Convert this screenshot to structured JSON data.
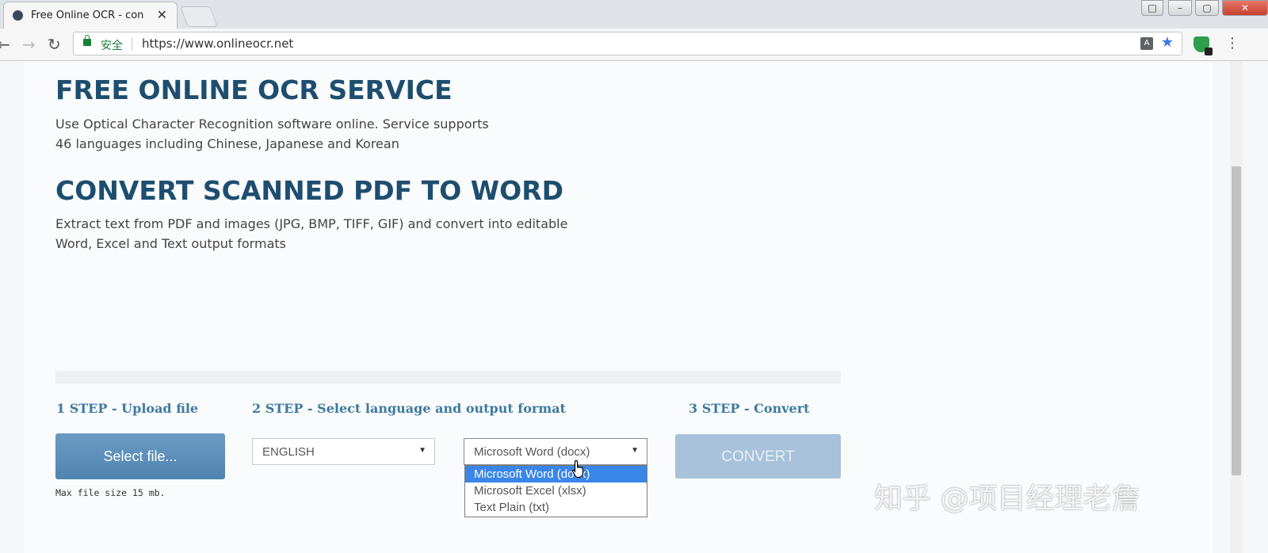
{
  "browser": {
    "tab": {
      "title": "Free Online OCR - con",
      "close": "✕"
    },
    "window_buttons": [
      "□",
      "–",
      "▢",
      "✕"
    ],
    "nav": {
      "back": "←",
      "forward": "→",
      "reload": "↻"
    },
    "address": {
      "secure_label": "安全",
      "url": "https://www.onlineocr.net"
    },
    "menu": "⋮"
  },
  "page": {
    "heading1": "FREE ONLINE OCR SERVICE",
    "desc1_line1": "Use Optical Character Recognition software online. Service supports",
    "desc1_line2": "46 languages including Chinese, Japanese and Korean",
    "heading2": "CONVERT SCANNED PDF TO WORD",
    "desc2_line1": "Extract text from PDF and images (JPG, BMP, TIFF, GIF) and convert into editable",
    "desc2_line2": "Word, Excel and Text output formats",
    "steps": {
      "step1": "1 STEP - Upload file",
      "step2": "2 STEP - Select language and output format",
      "step3": "3 STEP - Convert"
    },
    "select_file_label": "Select file...",
    "max_size": "Max file size 15 mb.",
    "language_select": "ENGLISH",
    "format_select": "Microsoft Word (docx)",
    "format_options": [
      "Microsoft Word (docx)",
      "Microsoft Excel (xlsx)",
      "Text Plain (txt)"
    ],
    "convert_label": "CONVERT"
  },
  "watermark": "知乎 @项目经理老詹",
  "colors": {
    "heading": "#1d4e6f",
    "step": "#3d7aa0",
    "button": "#5b8fbb",
    "convert_disabled": "#a7c2da",
    "option_selected": "#3a86e8"
  }
}
